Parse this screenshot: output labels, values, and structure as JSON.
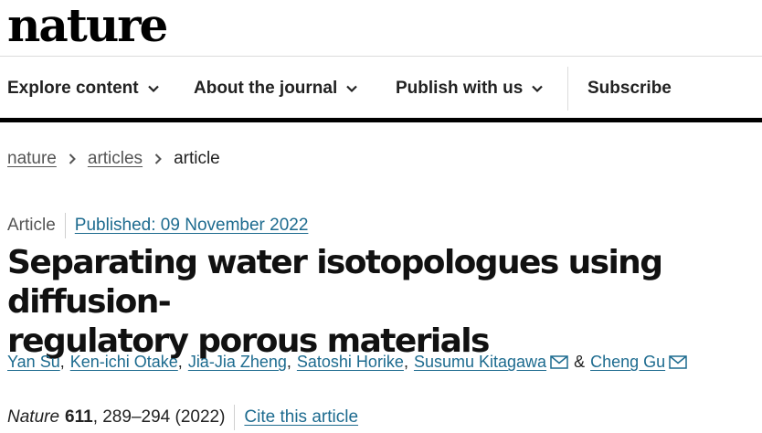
{
  "site": {
    "logo": "nature"
  },
  "nav": {
    "items": [
      {
        "label": "Explore content"
      },
      {
        "label": "About the journal"
      },
      {
        "label": "Publish with us"
      }
    ],
    "subscribe": "Subscribe"
  },
  "breadcrumb": {
    "home": "nature",
    "section": "articles",
    "current": "article"
  },
  "article": {
    "type": "Article",
    "published": "Published: 09 November 2022",
    "title_line1": "Separating water isotopologues using diffusion-",
    "title_line2": "regulatory porous materials",
    "authors": [
      {
        "name": "Yan Su"
      },
      {
        "name": "Ken-ichi Otake"
      },
      {
        "name": "Jia-Jia Zheng"
      },
      {
        "name": "Satoshi Horike"
      },
      {
        "name": "Susumu Kitagawa"
      },
      {
        "name": "Cheng Gu"
      }
    ],
    "amp": "&",
    "journal": "Nature",
    "volume": "611",
    "pages": ", 289–294 (2022)",
    "cite": "Cite this article"
  },
  "colors": {
    "link": "#1d6b8f",
    "text": "#222222",
    "muted": "#555555",
    "rule": "#000000"
  }
}
